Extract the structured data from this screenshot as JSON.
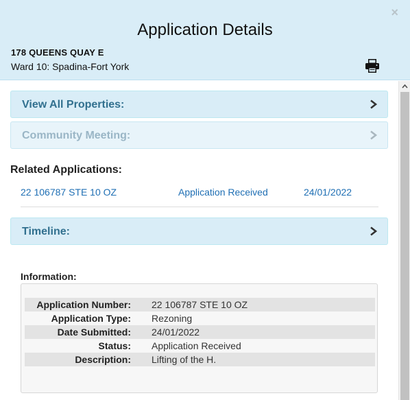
{
  "header": {
    "title": "Application Details",
    "close_glyph": "×",
    "address": "178 QUEENS QUAY E",
    "ward": "Ward 10: Spadina-Fort York",
    "print_icon": "printer-icon"
  },
  "panels": {
    "view_all": "View All Properties:",
    "community": "Community Meeting:",
    "timeline": "Timeline:"
  },
  "related": {
    "title": "Related Applications:",
    "rows": [
      {
        "number": "22 106787 STE 10 OZ",
        "status": "Application Received",
        "date": "24/01/2022"
      }
    ]
  },
  "information": {
    "title": "Information:",
    "fields": [
      {
        "label": "Application Number:",
        "value": "22 106787 STE 10 OZ"
      },
      {
        "label": "Application Type:",
        "value": "Rezoning"
      },
      {
        "label": "Date Submitted:",
        "value": "24/01/2022"
      },
      {
        "label": "Status:",
        "value": "Application Received"
      },
      {
        "label": "Description:",
        "value": "Lifting of the H."
      }
    ]
  },
  "colors": {
    "header_bg": "#d9edf7",
    "panel_text": "#31708f",
    "link": "#1f6fb4"
  }
}
